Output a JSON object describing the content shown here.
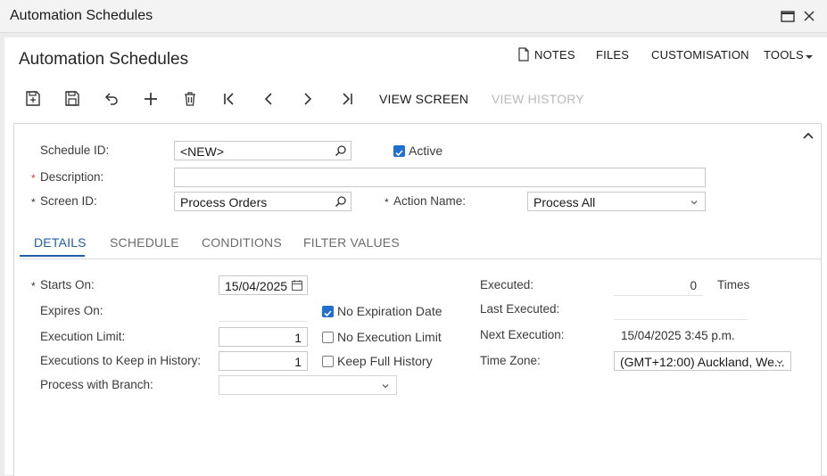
{
  "window": {
    "title": "Automation Schedules"
  },
  "header": {
    "page_title": "Automation Schedules",
    "links": {
      "notes": "NOTES",
      "files": "FILES",
      "customisation": "CUSTOMISATION",
      "tools": "TOOLS"
    }
  },
  "toolbar": {
    "view_screen": "VIEW SCREEN",
    "view_history": "VIEW HISTORY"
  },
  "form": {
    "schedule_id": {
      "label": "Schedule ID:",
      "value": "<NEW>"
    },
    "active": {
      "label": "Active",
      "checked": true
    },
    "description": {
      "label": "Description:",
      "value": ""
    },
    "screen_id": {
      "label": "Screen ID:",
      "value": "Process Orders"
    },
    "action_name": {
      "label": "Action Name:",
      "value": "Process All"
    }
  },
  "tabs": [
    {
      "label": "DETAILS",
      "active": true
    },
    {
      "label": "SCHEDULE"
    },
    {
      "label": "CONDITIONS"
    },
    {
      "label": "FILTER VALUES"
    }
  ],
  "details": {
    "starts_on": {
      "label": "Starts On:",
      "value": "15/04/2025"
    },
    "expires_on": {
      "label": "Expires On:"
    },
    "no_expiration": {
      "label": "No Expiration Date",
      "checked": true
    },
    "execution_limit": {
      "label": "Execution Limit:",
      "value": "1"
    },
    "no_execution_limit": {
      "label": "No Execution Limit",
      "checked": false
    },
    "keep_history": {
      "label": "Executions to Keep in History:",
      "value": "1"
    },
    "keep_full_history": {
      "label": "Keep Full History",
      "checked": false
    },
    "branch": {
      "label": "Process with Branch:",
      "value": ""
    },
    "executed": {
      "label": "Executed:",
      "value": "0",
      "unit": "Times"
    },
    "last_executed": {
      "label": "Last Executed:",
      "value": ""
    },
    "next_execution": {
      "label": "Next Execution:",
      "value": "15/04/2025 3:45 p.m."
    },
    "time_zone": {
      "label": "Time Zone:",
      "value": "(GMT+12:00) Auckland, We..."
    }
  },
  "colors": {
    "accent": "#1f5fa8",
    "checkbox": "#1f6ed1",
    "required": "#d23b3b"
  }
}
